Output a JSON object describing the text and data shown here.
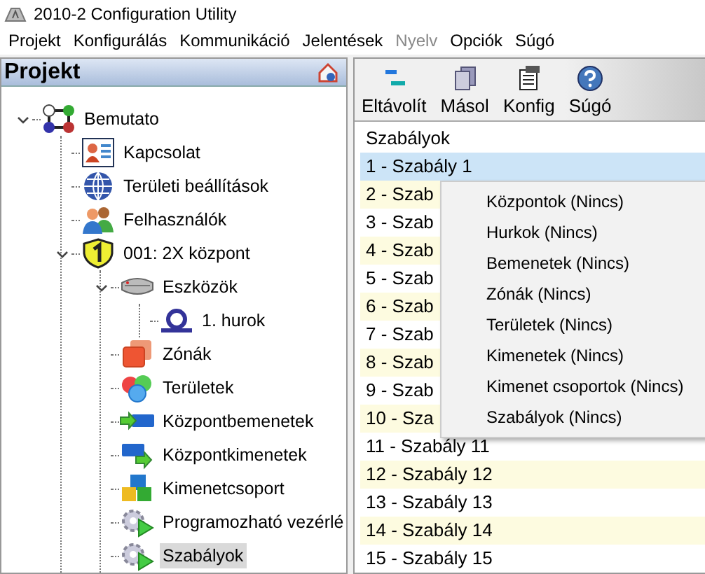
{
  "window": {
    "title": "2010-2 Configuration Utility"
  },
  "menu": [
    {
      "label": "Projekt",
      "disabled": false
    },
    {
      "label": "Konfigurálás",
      "disabled": false
    },
    {
      "label": "Kommunikáció",
      "disabled": false
    },
    {
      "label": "Jelentések",
      "disabled": false
    },
    {
      "label": "Nyelv",
      "disabled": true
    },
    {
      "label": "Opciók",
      "disabled": false
    },
    {
      "label": "Súgó",
      "disabled": false
    }
  ],
  "sidebar": {
    "title": "Projekt",
    "tree": [
      {
        "label": "Bemutato",
        "kind": "project",
        "expanded": true,
        "selected": false,
        "children": [
          {
            "label": "Kapcsolat",
            "kind": "connection",
            "selected": false
          },
          {
            "label": "Területi beállítások",
            "kind": "globe",
            "selected": false
          },
          {
            "label": "Felhasználók",
            "kind": "users",
            "selected": false
          },
          {
            "label": "001: 2X központ",
            "kind": "panel",
            "expanded": true,
            "selected": false,
            "children": [
              {
                "label": "Eszközök",
                "kind": "detector",
                "expanded": true,
                "selected": false,
                "children": [
                  {
                    "label": "1. hurok",
                    "kind": "loop",
                    "selected": false
                  }
                ]
              },
              {
                "label": "Zónák",
                "kind": "zones",
                "selected": false
              },
              {
                "label": "Területek",
                "kind": "areas",
                "selected": false
              },
              {
                "label": "Központbemenetek",
                "kind": "inputs",
                "selected": false
              },
              {
                "label": "Központkimenetek",
                "kind": "outputs",
                "selected": false
              },
              {
                "label": "Kimenetcsoport",
                "kind": "cubes",
                "selected": false
              },
              {
                "label": "Programozható vezérlé",
                "kind": "gears",
                "selected": false
              },
              {
                "label": "Szabályok",
                "kind": "gears",
                "selected": true
              }
            ]
          }
        ]
      }
    ]
  },
  "toolbar": [
    {
      "label": "Eltávolít",
      "kind": "remove"
    },
    {
      "label": "Másol",
      "kind": "copy"
    },
    {
      "label": "Konfig",
      "kind": "config"
    },
    {
      "label": "Súgó",
      "kind": "help"
    }
  ],
  "list": {
    "header": "Szabályok",
    "rows": [
      {
        "label": "1 - Szabály 1",
        "selected": true
      },
      {
        "label": "2 - Szab",
        "selected": false
      },
      {
        "label": "3 - Szab",
        "selected": false
      },
      {
        "label": "4 - Szab",
        "selected": false
      },
      {
        "label": "5 - Szab",
        "selected": false
      },
      {
        "label": "6 - Szab",
        "selected": false
      },
      {
        "label": "7 - Szab",
        "selected": false
      },
      {
        "label": "8 - Szab",
        "selected": false
      },
      {
        "label": "9 - Szab",
        "selected": false
      },
      {
        "label": "10 - Sza",
        "selected": false
      },
      {
        "label": "11 - Szabály 11",
        "selected": false
      },
      {
        "label": "12 - Szabály 12",
        "selected": false
      },
      {
        "label": "13 - Szabály 13",
        "selected": false
      },
      {
        "label": "14 - Szabály 14",
        "selected": false
      },
      {
        "label": "15 - Szabály 15",
        "selected": false
      }
    ]
  },
  "context_menu": [
    "Központok (Nincs)",
    "Hurkok (Nincs)",
    "Bemenetek (Nincs)",
    "Zónák (Nincs)",
    "Területek (Nincs)",
    "Kimenetek (Nincs)",
    "Kimenet csoportok (Nincs)",
    "Szabályok (Nincs)"
  ]
}
